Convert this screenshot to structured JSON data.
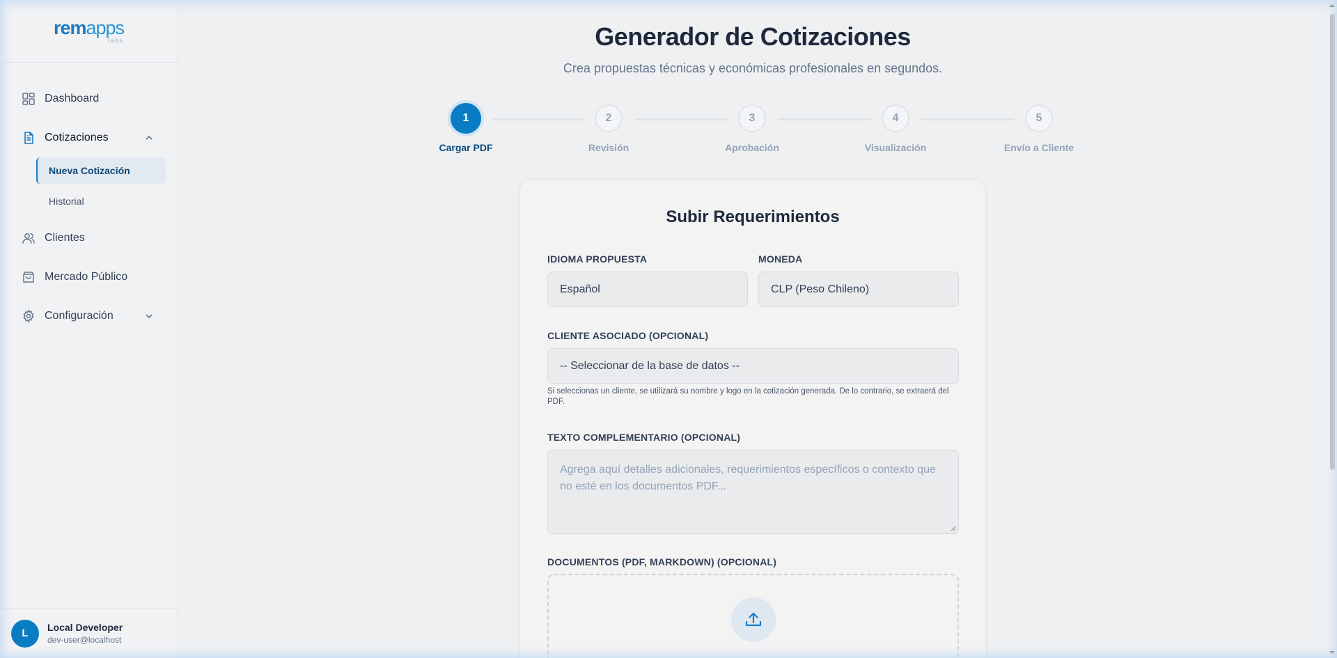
{
  "brand": {
    "logo_bold": "rem",
    "logo_light": "apps",
    "logo_sub": "labs"
  },
  "sidebar": {
    "items": [
      {
        "label": "Dashboard",
        "icon": "dashboard-grid-icon"
      },
      {
        "label": "Cotizaciones",
        "icon": "document-icon",
        "expanded": true
      },
      {
        "label": "Clientes",
        "icon": "users-icon"
      },
      {
        "label": "Mercado Público",
        "icon": "shopping-bag-icon"
      },
      {
        "label": "Configuración",
        "icon": "gear-icon",
        "expanded": false
      }
    ],
    "subitems": [
      {
        "label": "Nueva Cotización",
        "active": true
      },
      {
        "label": "Historial",
        "active": false
      }
    ]
  },
  "user": {
    "initial": "L",
    "name": "Local Developer",
    "email": "dev-user@localhost"
  },
  "header": {
    "title": "Generador de Cotizaciones",
    "subtitle": "Crea propuestas técnicas y económicas profesionales en segundos."
  },
  "stepper": {
    "current": 1,
    "steps": [
      {
        "number": "1",
        "label": "Cargar PDF"
      },
      {
        "number": "2",
        "label": "Revisión"
      },
      {
        "number": "3",
        "label": "Aprobación"
      },
      {
        "number": "4",
        "label": "Visualización"
      },
      {
        "number": "5",
        "label": "Envío a Cliente"
      }
    ]
  },
  "form": {
    "title": "Subir Requerimientos",
    "language": {
      "label": "IDIOMA PROPUESTA",
      "value": "Español"
    },
    "currency": {
      "label": "MONEDA",
      "value": "CLP (Peso Chileno)"
    },
    "client": {
      "label": "CLIENTE ASOCIADO (OPCIONAL)",
      "value": "-- Seleccionar de la base de datos --",
      "helper": "Si seleccionas un cliente, se utilizará su nombre y logo en la cotización generada. De lo contrario, se extraerá del PDF."
    },
    "extra_text": {
      "label": "TEXTO COMPLEMENTARIO (OPCIONAL)",
      "placeholder": "Agrega aquí detalles adicionales, requerimientos específicos o contexto que no esté en los documentos PDF..."
    },
    "documents": {
      "label": "DOCUMENTOS (PDF, MARKDOWN) (OPCIONAL)",
      "icon": "upload-icon"
    }
  },
  "colors": {
    "accent": "#0a7cc4",
    "accent_dark": "#0b4a7a",
    "background": "#eef0f2"
  }
}
